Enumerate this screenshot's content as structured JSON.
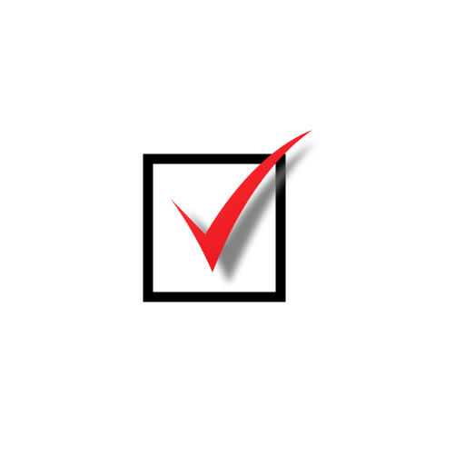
{
  "checkbox": {
    "checked": true,
    "icon": "checkmark-icon",
    "colors": {
      "background": "#ffffff",
      "box_border": "#000000",
      "box_fill": "#ffffff",
      "check_main": "#e30613",
      "check_highlight": "#ff3b3b",
      "shadow": "#6e6e6e"
    }
  }
}
